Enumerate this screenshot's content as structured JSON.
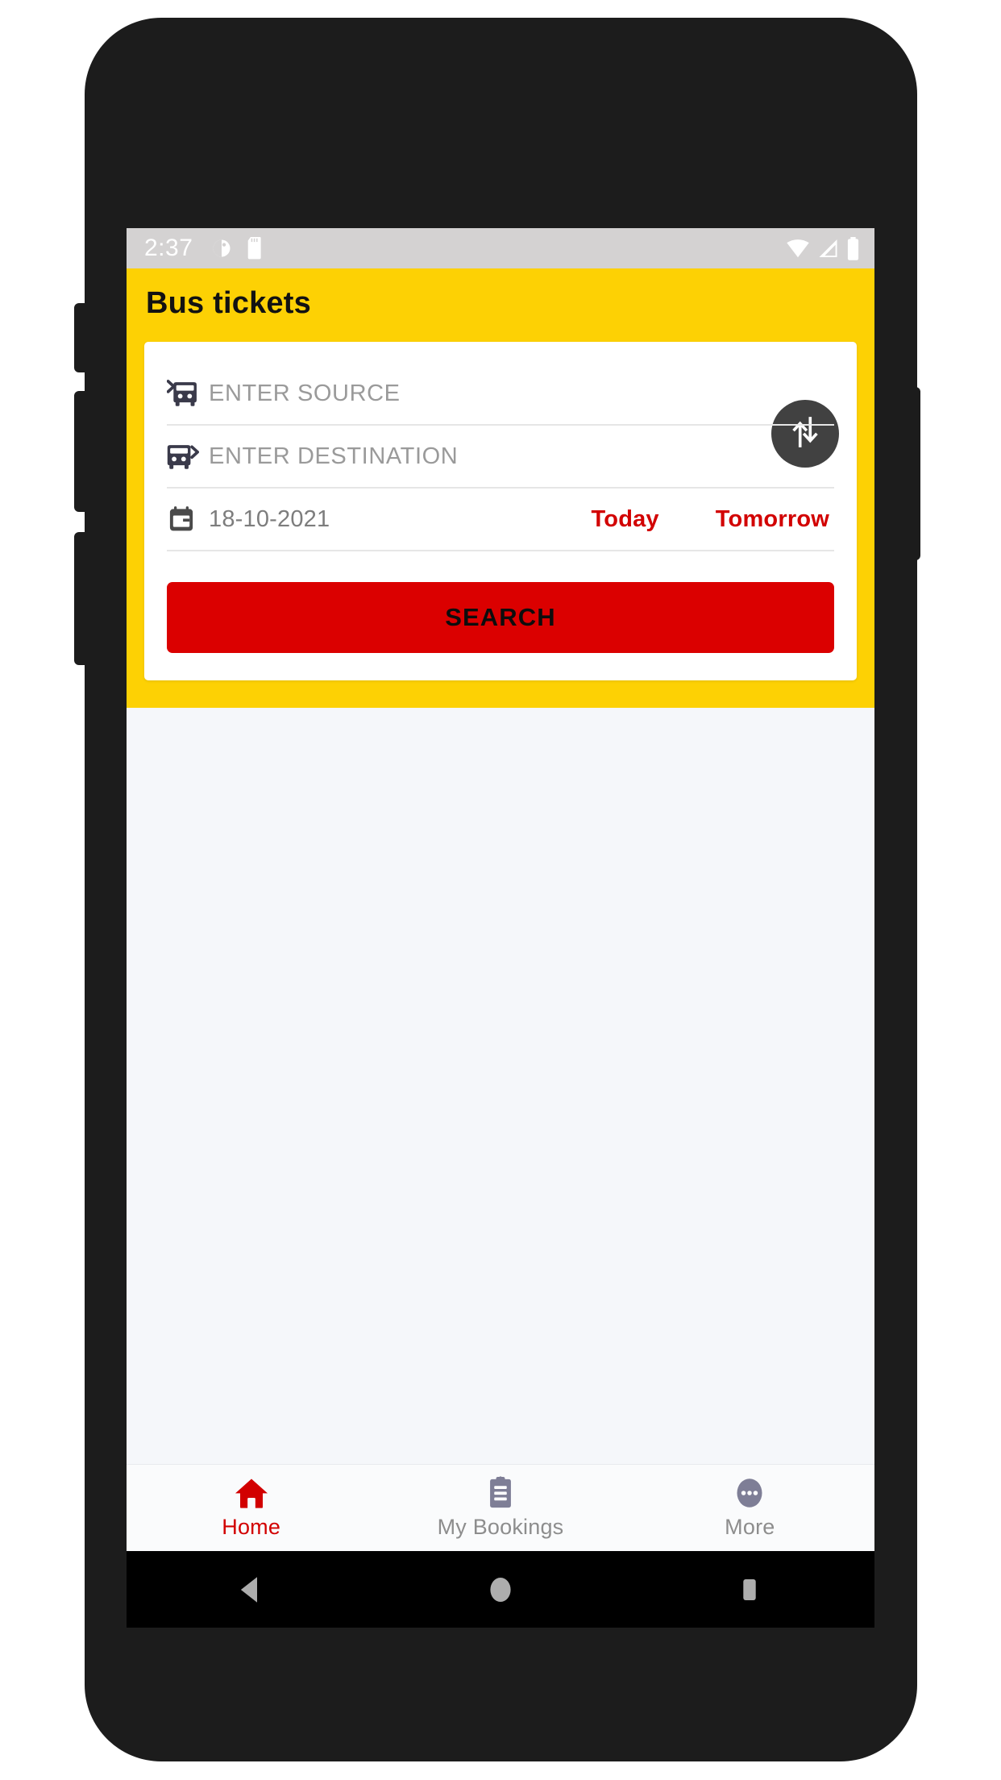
{
  "statusbar": {
    "time": "2:37",
    "left_icons": [
      "location-icon",
      "sd-card-icon"
    ],
    "right_icons": [
      "wifi-icon",
      "signal-icon",
      "battery-icon"
    ]
  },
  "header": {
    "title": "Bus tickets",
    "background_color": "#FDD104"
  },
  "search_card": {
    "source": {
      "icon": "bus-arrive-icon",
      "placeholder": "ENTER SOURCE",
      "value": ""
    },
    "destination": {
      "icon": "bus-depart-icon",
      "placeholder": "ENTER DESTINATION",
      "value": ""
    },
    "date": {
      "icon": "calendar-icon",
      "value": "18-10-2021"
    },
    "quick_dates": [
      {
        "label": "Today"
      },
      {
        "label": "Tomorrow"
      }
    ],
    "swap_button": {
      "icon": "swap-vertical-icon"
    },
    "search_button": {
      "label": "SEARCH",
      "background_color": "#DB0000",
      "text_color": "#0D0D0D"
    },
    "accent_color": "#D20000"
  },
  "bottom_nav": {
    "items": [
      {
        "label": "Home",
        "icon": "home-icon",
        "active": true
      },
      {
        "label": "My Bookings",
        "icon": "clipboard-icon",
        "active": false
      },
      {
        "label": "More",
        "icon": "more-dots-icon",
        "active": false
      }
    ],
    "active_color": "#D20000",
    "inactive_color": "#8D8D8D"
  },
  "android_nav": {
    "buttons": [
      "back-icon",
      "home-circle-icon",
      "recents-square-icon"
    ]
  }
}
